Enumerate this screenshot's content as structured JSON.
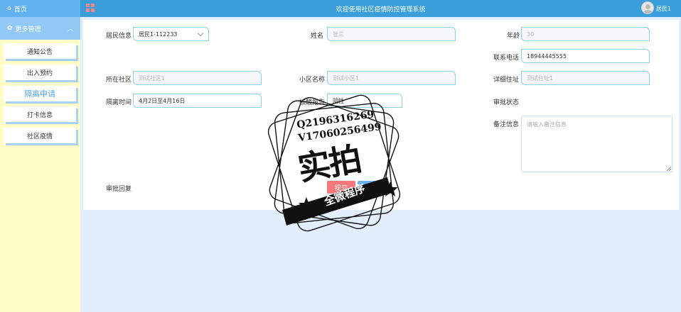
{
  "sidebar": {
    "home": {
      "label": "首页",
      "icon": "home-icon"
    },
    "more": {
      "label": "更多管理",
      "icon": "flower-icon"
    },
    "items": [
      {
        "label": "通知公告",
        "active": false
      },
      {
        "label": "出入预约",
        "active": false
      },
      {
        "label": "隔离申请",
        "active": true
      },
      {
        "label": "打卡信息",
        "active": false
      },
      {
        "label": "社区疫情",
        "active": false
      }
    ]
  },
  "header": {
    "title": "欢迎使用社区疫情防控管理系统",
    "user": "居民1"
  },
  "form": {
    "resident": {
      "label": "居民信息",
      "value": "居民1-112233"
    },
    "name": {
      "label": "姓名",
      "value": "张三"
    },
    "age": {
      "label": "年龄",
      "value": "30"
    },
    "phone": {
      "label": "联系电话",
      "value": "18944445555"
    },
    "community": {
      "label": "所在社区",
      "value": "测试社区1"
    },
    "district": {
      "label": "小区名称",
      "value": "测试小区1"
    },
    "address": {
      "label": "详细住址",
      "value": "测试住址1"
    },
    "isolation_time": {
      "label": "隔离时间",
      "value": "4月2日至4月16日"
    },
    "report": {
      "label": "核酸报告",
      "value": "阴性"
    },
    "audit_status": {
      "label": "审批状态"
    },
    "remark": {
      "label": "备注信息",
      "placeholder": "请输入备注信息"
    },
    "audit_reply": {
      "label": "审批回复"
    },
    "submit_label": "提交"
  },
  "watermark": {
    "line1": "Q2196316269",
    "line2": "V17060256499",
    "big": "实拍",
    "band": "全微程序"
  },
  "colors": {
    "header": "#3a9edb",
    "sidebar_bg": "#fffcc8",
    "sidebar_top": "#62b2ef",
    "accent": "#5aa6e6",
    "field_border": "#8fd2e6",
    "submit": "#f2787a"
  }
}
